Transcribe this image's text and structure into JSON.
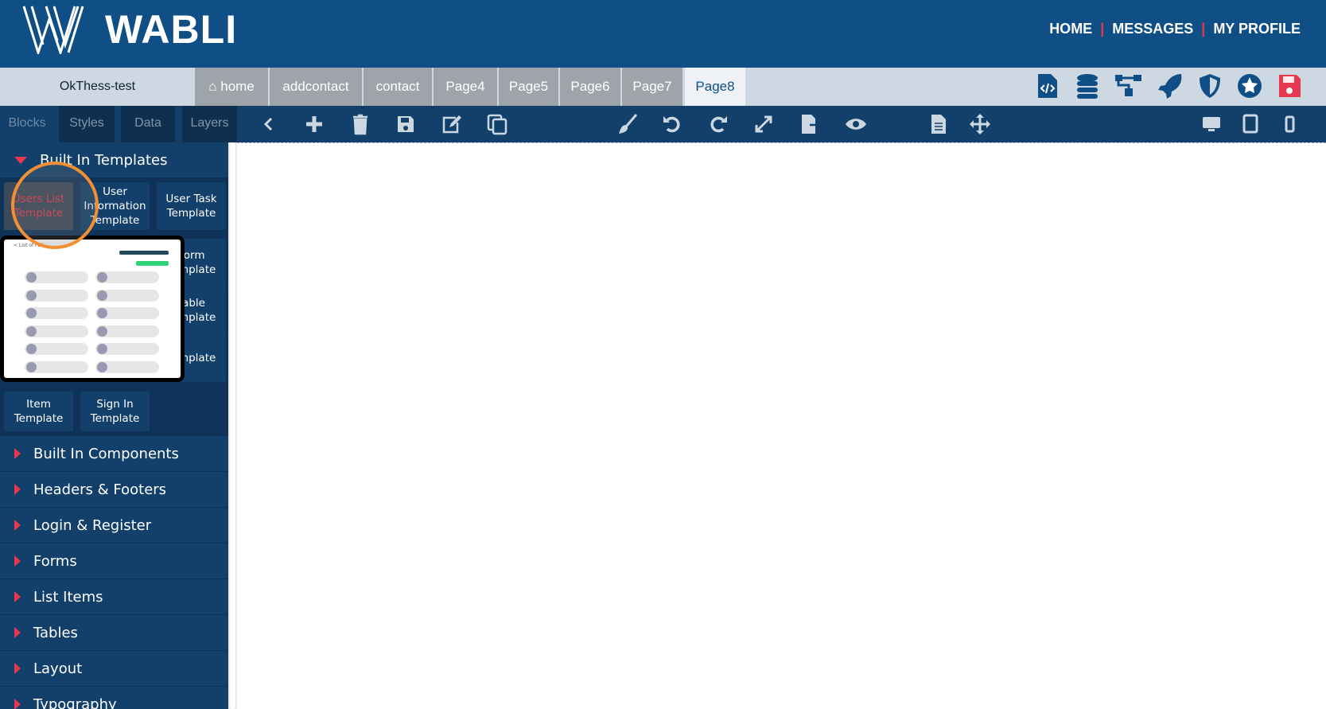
{
  "header": {
    "brand": "WABLI",
    "nav": [
      "HOME",
      "MESSAGES",
      "MY PROFILE"
    ]
  },
  "project": "OkThess-test",
  "pages": [
    {
      "label": "home",
      "icon": "home-icon"
    },
    {
      "label": "addcontact"
    },
    {
      "label": "contact"
    },
    {
      "label": "Page4"
    },
    {
      "label": "Page5"
    },
    {
      "label": "Page6"
    },
    {
      "label": "Page7"
    },
    {
      "label": "Page8",
      "active": true
    }
  ],
  "top_icons": [
    "code-file-icon",
    "database-icon",
    "sitemap-icon",
    "rocket-icon",
    "shield-icon",
    "star-badge-icon",
    "save-icon"
  ],
  "panel_tabs": [
    "Blocks",
    "Styles",
    "Data",
    "Layers"
  ],
  "toolbar_icons": [
    "back-icon",
    "plus-icon",
    "trash-icon",
    "save-icon",
    "edit-icon",
    "copy-icon",
    "brush-icon",
    "undo-icon",
    "redo-icon",
    "fullscreen-icon",
    "export-icon",
    "eye-icon",
    "page-icon",
    "move-icon",
    "desktop-icon",
    "tablet-icon",
    "mobile-icon"
  ],
  "sidebar": {
    "open_category": "Built In Templates",
    "templates": [
      "Users List Template",
      "User Information Template",
      "User Task Template",
      "Form Template",
      "Table Template",
      "Template",
      "Item Template",
      "Sign In Template"
    ],
    "preview_title": "< List of Pati",
    "categories": [
      "Built In Components",
      "Headers & Footers",
      "Login & Register",
      "Forms",
      "List Items",
      "Tables",
      "Layout",
      "Typography"
    ]
  },
  "colors": {
    "primary": "#0f4f85",
    "accent": "#e8384f",
    "highlight": "#f28f34"
  }
}
